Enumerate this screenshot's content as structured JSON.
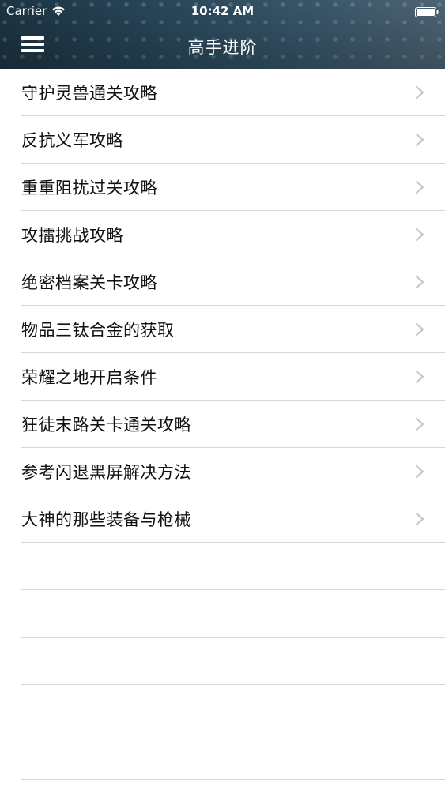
{
  "status_bar": {
    "carrier": "Carrier",
    "time": "10:42 AM"
  },
  "nav": {
    "title": "高手进阶",
    "menu_icon": "hamburger-menu-icon"
  },
  "list": {
    "items": [
      {
        "label": "守护灵兽通关攻略"
      },
      {
        "label": "反抗义军攻略"
      },
      {
        "label": "重重阻扰过关攻略"
      },
      {
        "label": "攻擂挑战攻略"
      },
      {
        "label": "绝密档案关卡攻略"
      },
      {
        "label": "物品三钛合金的获取"
      },
      {
        "label": "荣耀之地开启条件"
      },
      {
        "label": "狂徒末路关卡通关攻略"
      },
      {
        "label": "参考闪退黑屏解决方法"
      },
      {
        "label": "大神的那些装备与枪械"
      }
    ],
    "empty_rows": 5
  },
  "colors": {
    "header_dark": "#1e3746",
    "header_light": "#52697a",
    "separator": "#d6d6d9",
    "chevron": "#c7c7cc",
    "text": "#111111"
  }
}
